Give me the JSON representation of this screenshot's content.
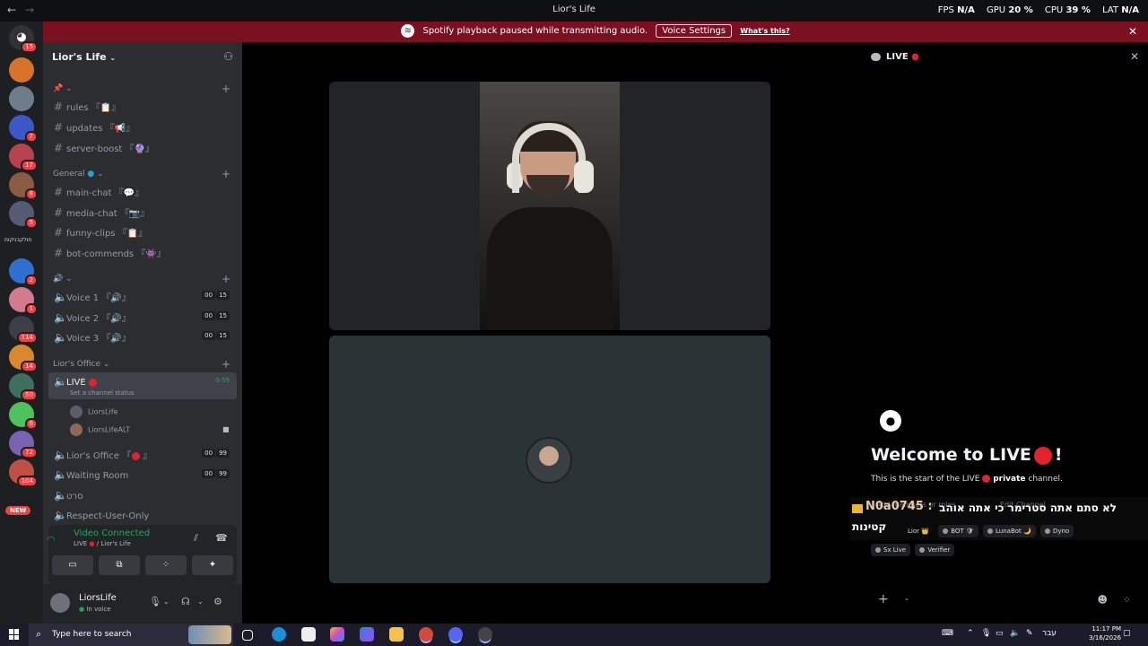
{
  "window": {
    "title": "Lior's Life",
    "back": "←",
    "forward": "→"
  },
  "perf": {
    "fps_label": "FPS",
    "fps": "N/A",
    "gpu_label": "GPU",
    "gpu": "20 %",
    "cpu_label": "CPU",
    "cpu": "39 %",
    "lat_label": "LAT",
    "lat": "N/A"
  },
  "notice": {
    "text": "Spotify playback paused while transmitting audio.",
    "button": "Voice Settings",
    "link": "What's this?"
  },
  "servers": {
    "badges": [
      "15",
      "7",
      "17",
      "6",
      "5",
      "2",
      "1",
      "114",
      "14",
      "50",
      "6",
      "72",
      "104"
    ],
    "text_server": "חולקבניקות",
    "new_label": "NEW"
  },
  "guild": {
    "name": "Lior's Life"
  },
  "categories": {
    "pinned": "📌",
    "general": "General",
    "voice": "🔊",
    "office": "Lior's Office"
  },
  "text_channels": [
    {
      "name": "rules 『📋』"
    },
    {
      "name": "updates 『📢』"
    },
    {
      "name": "server-boost 『🔮』"
    },
    {
      "name": "main-chat 『💬』"
    },
    {
      "name": "media-chat 『📷』"
    },
    {
      "name": "funny-clips 『📋』"
    },
    {
      "name": "bot-commends 『👾』"
    }
  ],
  "voice_channels": [
    {
      "name": "Voice 1 『🔊』",
      "count": "00",
      "limit": "15"
    },
    {
      "name": "Voice 2 『🔊』",
      "count": "00",
      "limit": "15"
    },
    {
      "name": "Voice 3 『🔊』",
      "count": "00",
      "limit": "15"
    }
  ],
  "live_channel": {
    "name": "LIVE",
    "status": "Set a channel status",
    "timer": "0:59"
  },
  "voice_users": [
    "LiorsLife",
    "LiorsLifeALT"
  ],
  "office_channels": [
    {
      "name": "Lior's Office 『",
      "count": "00",
      "limit": "99"
    },
    {
      "name": "Waiting Room",
      "count": "00",
      "limit": "99"
    },
    {
      "name": "סרט"
    },
    {
      "name": "Respect-User-Only"
    }
  ],
  "voice_connection": {
    "title": "Video Connected",
    "sub_channel": "LIVE",
    "sub_server": "/ Lior's Life"
  },
  "user": {
    "name": "LiorsLife",
    "status": "In voice"
  },
  "chat": {
    "header": "LIVE",
    "welcome_prefix": "Welcome to LIVE",
    "welcome_suffix": "!",
    "start_prefix": "This is the start of the LIVE",
    "start_private": "private",
    "start_suffix": "channel.",
    "ghost_add": "Add members or roles",
    "ghost_edit": "Edit Channel",
    "overlay_user": "N0a0745 :",
    "overlay_msg": "לא סתם אתה סטרימר כי אתה אוהב",
    "overlay_msg2": "קטינות",
    "roles_row1": [
      "Lior 👑",
      "BOT 🛡",
      "LunaBot 🌙",
      "Dyno"
    ],
    "roles_row2": [
      "Sx Live",
      "Verifier"
    ]
  },
  "taskbar": {
    "search": "Type here to search",
    "lang": "עבר",
    "time": "11:17 PM",
    "date": "3/16/2026"
  }
}
